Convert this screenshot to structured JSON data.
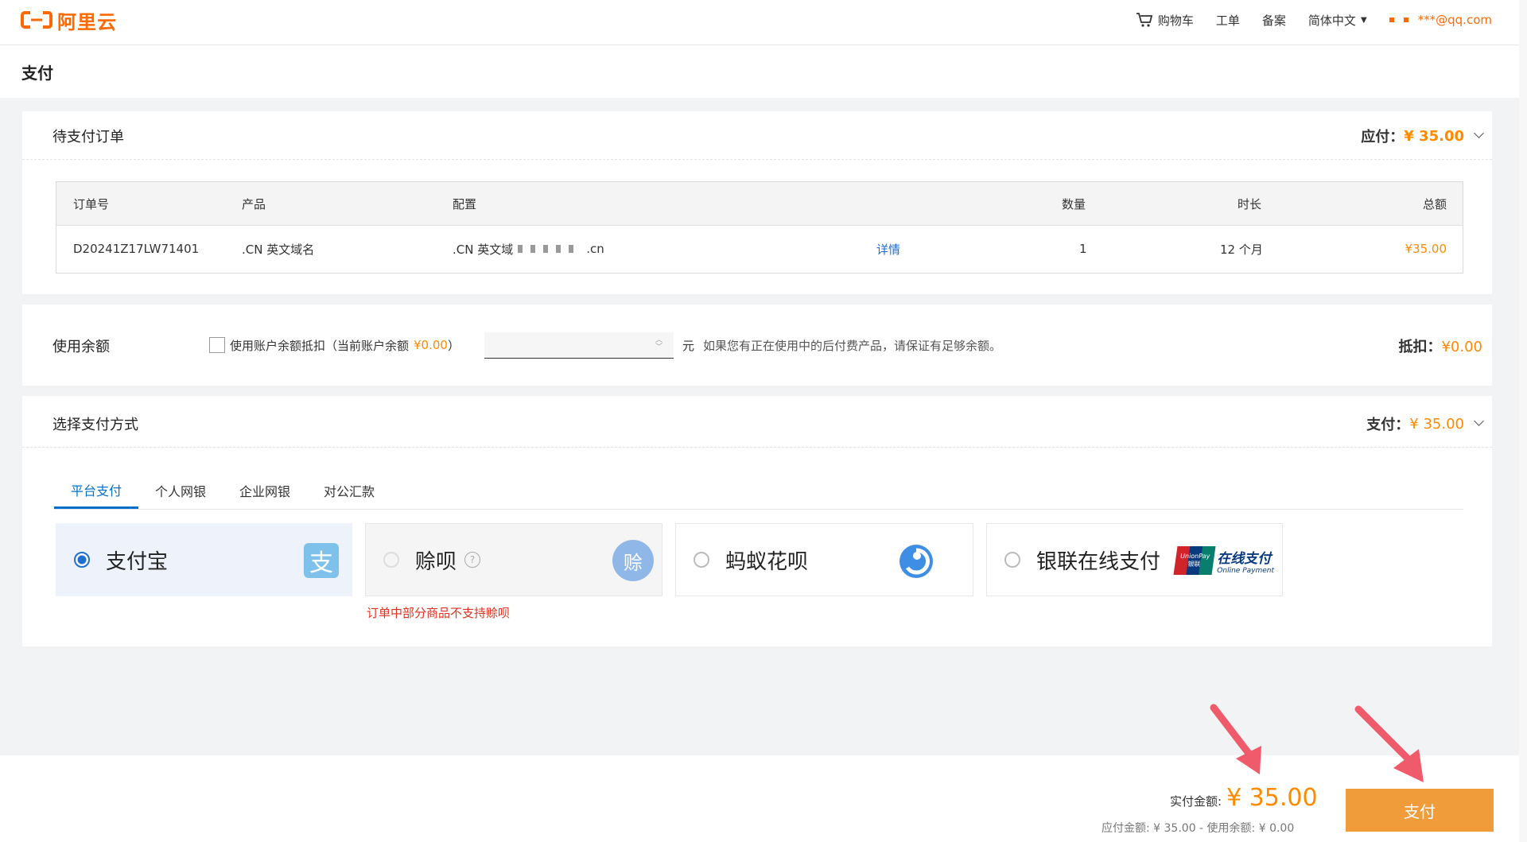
{
  "header": {
    "logo_text": "阿里云",
    "cart": "购物车",
    "ticket": "工单",
    "filing": "备案",
    "language": "简体中文",
    "user": "***@qq.com"
  },
  "page_title": "支付",
  "order": {
    "title": "待支付订单",
    "due_label": "应付：",
    "due_amount": "¥ 35.00",
    "columns": [
      "订单号",
      "产品",
      "配置",
      "数量",
      "时长",
      "总额"
    ],
    "row": {
      "id": "D20241Z17LW71401",
      "product": ".CN 英文域名",
      "config": ".CN 英文域",
      "config_suffix": ".cn",
      "detail": "详情",
      "qty": "1",
      "duration": "12 个月",
      "total": "¥35.00"
    }
  },
  "balance": {
    "title": "使用余额",
    "checkbox_label": "使用账户余额抵扣（当前账户余额",
    "balance_amount": "¥0.00",
    "close_paren": "）",
    "unit": "元",
    "note": "如果您有正在使用中的后付费产品，请保证有足够余额。",
    "deduct_label": "抵扣：",
    "deduct_amount": "¥0.00"
  },
  "payment": {
    "title": "选择支付方式",
    "pay_label": "支付：",
    "pay_amount": "¥ 35.00",
    "tabs": [
      "平台支付",
      "个人网银",
      "企业网银",
      "对公汇款"
    ],
    "options": [
      {
        "name": "支付宝",
        "selected": true
      },
      {
        "name": "赊呗",
        "selected": false,
        "disabled": true
      },
      {
        "name": "蚂蚁花呗",
        "selected": false
      },
      {
        "name": "银联在线支付",
        "selected": false
      }
    ],
    "warning": "订单中部分商品不支持赊呗",
    "unionpay_logo_cn": "在线支付",
    "unionpay_logo_en": "Online Payment",
    "unionpay_brand": "UnionPay",
    "unionpay_brand_cn": "银联"
  },
  "footer": {
    "actual_label": "实付金额:",
    "actual_amount": "¥ 35.00",
    "breakdown": "应付金额: ¥ 35.00 - 使用余额: ¥ 0.00",
    "pay_button": "支付"
  },
  "colors": {
    "accent": "#ff8a00",
    "primary_blue": "#0070cc",
    "pay_button": "#f09c3a",
    "warning": "#e0301e",
    "arrow": "#ef5b6b"
  }
}
